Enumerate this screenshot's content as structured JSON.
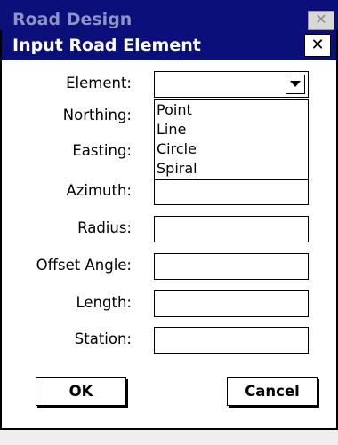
{
  "parent_window": {
    "title": "Road Design",
    "close_glyph": "✕"
  },
  "dialog": {
    "title": "Input Road Element",
    "close_glyph": "✕"
  },
  "form": {
    "element_label": "Element:",
    "element_value": "",
    "northing_label": "Northing:",
    "easting_label": "Easting:",
    "azimuth_label": "Azimuth:",
    "radius_label": "Radius:",
    "offset_angle_label": "Offset Angle:",
    "length_label": "Length:",
    "station_label": "Station:"
  },
  "element_dropdown": {
    "options": [
      "Point",
      "Line",
      "Circle",
      "Spiral"
    ]
  },
  "buttons": {
    "ok_label": "OK",
    "cancel_label": "Cancel"
  },
  "colors": {
    "titlebar": "#0a0f7a",
    "title_text": "#ffffff"
  }
}
